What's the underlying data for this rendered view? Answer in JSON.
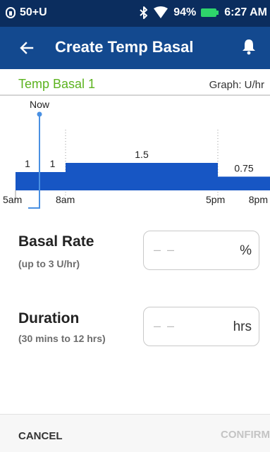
{
  "status_bar": {
    "carrier": "50+U",
    "battery_percent": "94%",
    "time": "6:27 AM",
    "icons": [
      "sim-lock-icon",
      "bluetooth-icon",
      "wifi-icon",
      "battery-icon"
    ]
  },
  "app_bar": {
    "title": "Create Temp Basal",
    "back_icon": "back-arrow-icon",
    "notification_icon": "bell-icon"
  },
  "header": {
    "profile_name": "Temp Basal 1",
    "graph_unit": "Graph: U/hr"
  },
  "chart_data": {
    "type": "bar",
    "now_label": "Now",
    "x_tick_labels": [
      "5am",
      "8am",
      "5pm",
      "8pm"
    ],
    "segments": [
      {
        "start": "5am",
        "end": "Now",
        "rate_label": "1",
        "rate": 1
      },
      {
        "start": "Now",
        "end": "8am",
        "rate_label": "1",
        "rate": 1
      },
      {
        "start": "8am",
        "end": "5pm",
        "rate_label": "1.5",
        "rate": 1.5
      },
      {
        "start": "5pm",
        "end": "8pm",
        "rate_label": "0.75",
        "rate": 0.75
      }
    ],
    "colors": {
      "bar": "#1756c4",
      "now_line": "#4a90e2",
      "gridline": "#9a9a9a"
    }
  },
  "form": {
    "basal_rate": {
      "label": "Basal Rate",
      "hint": "(up to 3 U/hr)",
      "placeholder": "– –",
      "unit": "%",
      "value": ""
    },
    "duration": {
      "label": "Duration",
      "hint": "(30 mins to 12 hrs)",
      "placeholder": "– –",
      "unit": "hrs",
      "value": ""
    }
  },
  "footer": {
    "cancel_label": "CANCEL",
    "confirm_label": "CONFIRM"
  },
  "colors": {
    "status_bar_bg": "#0b2d5e",
    "app_bar_bg": "#13498f",
    "profile_name": "#5cb31f",
    "confirm_disabled": "#c4c4c4"
  }
}
